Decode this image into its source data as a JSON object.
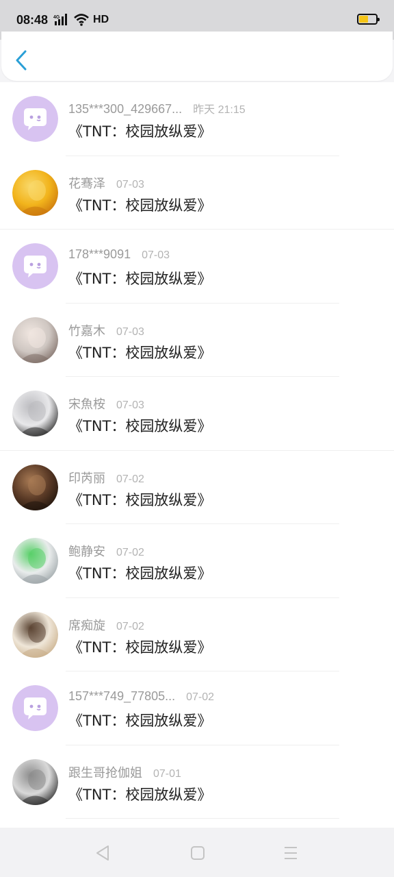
{
  "status_bar": {
    "time": "08:48",
    "network": "4G",
    "hd": "HD",
    "battery_level": 0.55,
    "battery_color": "#f5c518"
  },
  "header": {
    "back_icon": "chevron-left-icon",
    "accent": "#2a9fd6"
  },
  "items": [
    {
      "name": "135***300_429667...",
      "time": "昨天 21:15",
      "title": "《TNT：校园放纵爱》",
      "avatar": "default-chat-avatar"
    },
    {
      "name": "花骞泽",
      "time": "07-03",
      "title": "《TNT：校园放纵爱》",
      "avatar": "photo-avatar-golden"
    },
    {
      "name": "178***9091",
      "time": "07-03",
      "title": "《TNT：校园放纵爱》",
      "avatar": "default-chat-avatar"
    },
    {
      "name": "竹嘉木",
      "time": "07-03",
      "title": "《TNT：校园放纵爱》",
      "avatar": "photo-avatar-lion"
    },
    {
      "name": "宋魚桉",
      "time": "07-03",
      "title": "《TNT：校园放纵爱》",
      "avatar": "photo-avatar-boy"
    },
    {
      "name": "印芮丽",
      "time": "07-02",
      "title": "《TNT：校园放纵爱》",
      "avatar": "photo-avatar-dark"
    },
    {
      "name": "鲍静安",
      "time": "07-02",
      "title": "《TNT：校园放纵爱》",
      "avatar": "photo-avatar-green-banner"
    },
    {
      "name": "席痴旋",
      "time": "07-02",
      "title": "《TNT：校园放纵爱》",
      "avatar": "photo-avatar-lying"
    },
    {
      "name": "157***749_77805...",
      "time": "07-02",
      "title": "《TNT：校园放纵爱》",
      "avatar": "default-chat-avatar"
    },
    {
      "name": "跟生哥抢伽姐",
      "time": "07-01",
      "title": "《TNT：校园放纵爱》",
      "avatar": "photo-avatar-bw"
    }
  ],
  "nav": {
    "back": "nav-back-icon",
    "home": "nav-home-icon",
    "menu": "nav-menu-icon"
  }
}
